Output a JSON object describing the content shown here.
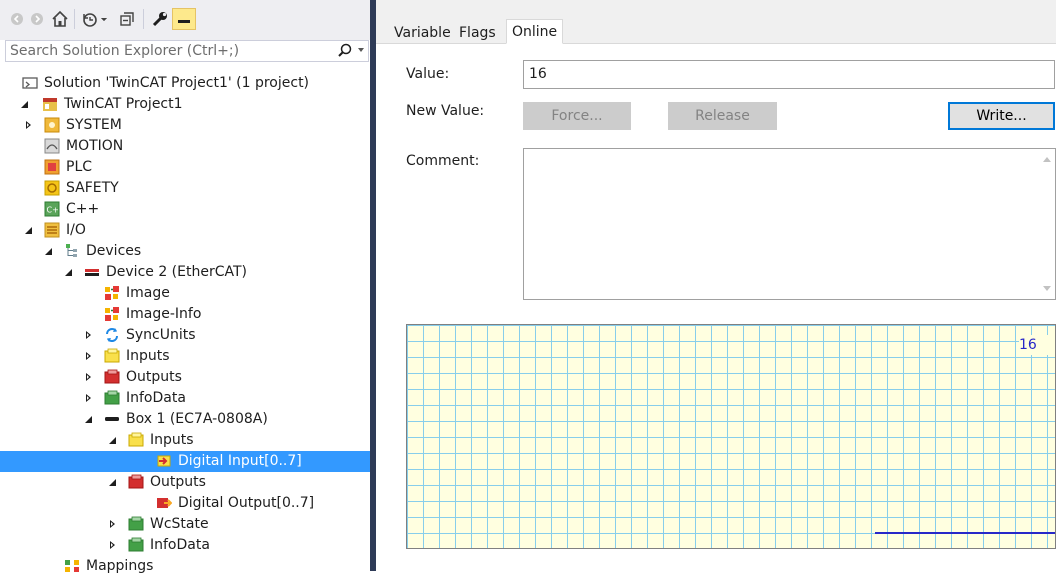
{
  "explorer": {
    "search": {
      "placeholder": "Search Solution Explorer (Ctrl+;)"
    },
    "toolbar": {
      "buttons": [
        "back-icon",
        "forward-icon",
        "home-icon",
        "history-icon",
        "collapse-all-icon",
        "properties-wrench-icon",
        "preview-icon"
      ]
    },
    "tree": [
      {
        "label": "Solution 'TwinCAT Project1' (1 project)",
        "level": 0,
        "exp": "none",
        "icon": "solution-icon"
      },
      {
        "label": "TwinCAT Project1",
        "level": 0,
        "exp": "expanded",
        "icon": "twincat-project-icon"
      },
      {
        "label": "SYSTEM",
        "level": 1,
        "exp": "collapsed",
        "icon": "system-icon"
      },
      {
        "label": "MOTION",
        "level": 1,
        "exp": "none",
        "icon": "motion-icon"
      },
      {
        "label": "PLC",
        "level": 1,
        "exp": "none",
        "icon": "plc-icon"
      },
      {
        "label": "SAFETY",
        "level": 1,
        "exp": "none",
        "icon": "safety-icon"
      },
      {
        "label": "C++",
        "level": 1,
        "exp": "none",
        "icon": "cpp-icon"
      },
      {
        "label": "I/O",
        "level": 1,
        "exp": "expanded",
        "icon": "io-icon"
      },
      {
        "label": "Devices",
        "level": 2,
        "exp": "expanded",
        "icon": "devices-icon"
      },
      {
        "label": "Device 2 (EtherCAT)",
        "level": 3,
        "exp": "expanded",
        "icon": "ethercat-device-icon"
      },
      {
        "label": "Image",
        "level": 4,
        "exp": "none",
        "icon": "image-icon"
      },
      {
        "label": "Image-Info",
        "level": 4,
        "exp": "none",
        "icon": "image-info-icon"
      },
      {
        "label": "SyncUnits",
        "level": 4,
        "exp": "collapsed",
        "icon": "syncunits-icon"
      },
      {
        "label": "Inputs",
        "level": 4,
        "exp": "collapsed",
        "icon": "inputs-folder-icon"
      },
      {
        "label": "Outputs",
        "level": 4,
        "exp": "collapsed",
        "icon": "outputs-folder-icon"
      },
      {
        "label": "InfoData",
        "level": 4,
        "exp": "collapsed",
        "icon": "infodata-folder-icon"
      },
      {
        "label": "Box 1 (EC7A-0808A)",
        "level": 4,
        "exp": "expanded",
        "icon": "box-icon"
      },
      {
        "label": "Inputs",
        "level": 5,
        "exp": "expanded",
        "icon": "inputs-folder-icon"
      },
      {
        "label": "Digital Input[0..7]",
        "level": 6,
        "exp": "none",
        "icon": "input-variable-icon",
        "selected": true
      },
      {
        "label": "Outputs",
        "level": 5,
        "exp": "expanded",
        "icon": "outputs-folder-icon"
      },
      {
        "label": "Digital Output[0..7]",
        "level": 6,
        "exp": "none",
        "icon": "output-variable-icon"
      },
      {
        "label": "WcState",
        "level": 5,
        "exp": "collapsed",
        "icon": "infodata-folder-icon"
      },
      {
        "label": "InfoData",
        "level": 5,
        "exp": "collapsed",
        "icon": "infodata-folder-icon"
      },
      {
        "label": "Mappings",
        "level": 2,
        "exp": "none",
        "icon": "mappings-icon"
      }
    ]
  },
  "props": {
    "tabs": [
      {
        "label": "Variable",
        "active": false
      },
      {
        "label": "Flags",
        "active": false
      },
      {
        "label": "Online",
        "active": true
      }
    ],
    "value_label": "Value:",
    "value": "16",
    "new_value_label": "New Value:",
    "force_label": "Force...",
    "release_label": "Release",
    "write_label": "Write...",
    "comment_label": "Comment:",
    "comment": "",
    "scope": {
      "current_value": "16",
      "trace_level": 0
    }
  },
  "colors": {
    "selection": "#3399ff",
    "splitter": "#2e3b57",
    "scope_bg": "#ffffe0",
    "scope_grid": "#87ceeb",
    "trace": "#2828c8"
  }
}
